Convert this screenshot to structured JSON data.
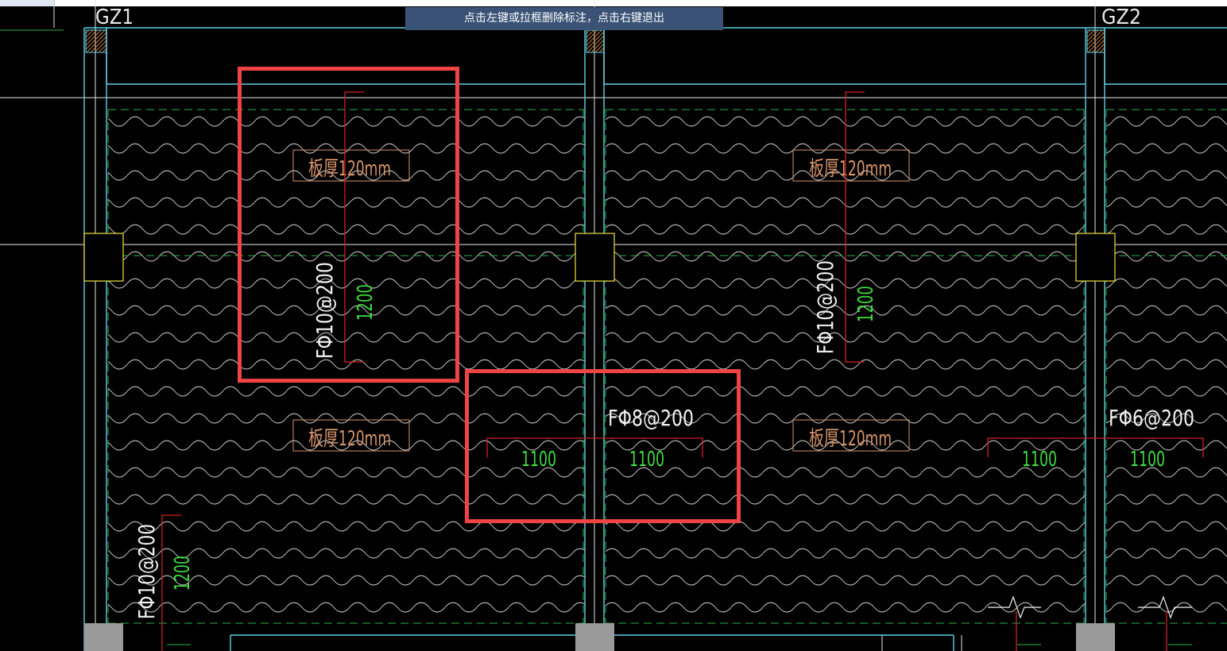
{
  "hint_text": "点击左键或拉框删除标注，点击右键退出",
  "column_labels": [
    "GZ1",
    "GZ2"
  ],
  "slab_labels": [
    "板厚120mm",
    "板厚120mm",
    "板厚120mm",
    "板厚120mm"
  ],
  "rebar_labels": {
    "left_vertical": "FΦ10@200",
    "right_vertical": "FΦ10@200",
    "bottom_left_vertical": "FΦ10@200",
    "middle_horizontal": "FΦ8@200",
    "right_horizontal": "FΦ6@200"
  },
  "dimensions": {
    "left_vertical": "1200",
    "right_vertical": "1200",
    "bottom_left_vertical": "1200",
    "middle_left": "1100",
    "middle_right": "1100",
    "right_left": "1100",
    "right_right": "1100"
  },
  "colors": {
    "background": "#000000",
    "beam_line": "#5fd3e6",
    "grid_line": "#f2f2f2",
    "hatch": "#d9d9d9",
    "dashed": "#2ab24a",
    "rebar": "#d22222",
    "dimension_text": "#3fdc3f",
    "slab_label": "#d7956a",
    "column": "#f2e23a",
    "highlight_box": "#f04444"
  }
}
